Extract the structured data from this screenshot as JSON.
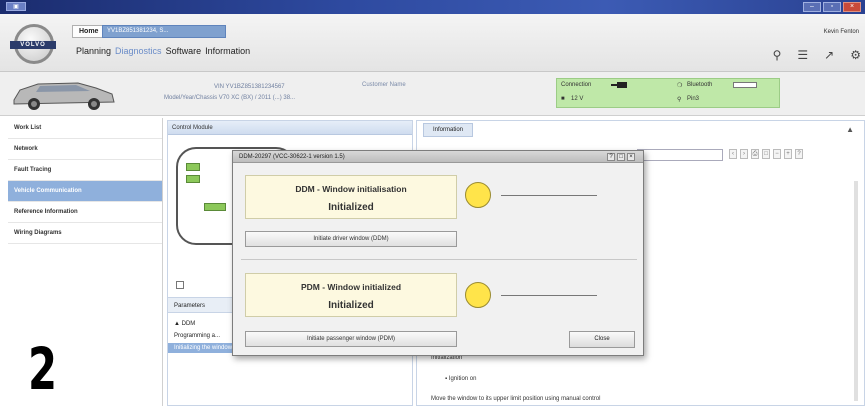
{
  "window": {
    "controls": [
      "–",
      "▫",
      "×"
    ]
  },
  "header": {
    "logo_text": "VOLVO",
    "tabs": [
      "Home",
      "YV1BZ851381234, S..."
    ],
    "nav": [
      "Planning",
      "Diagnostics",
      "Software",
      "Information"
    ],
    "active_nav": "Diagnostics",
    "user": "Kevin Fenton",
    "icons": [
      "search-icon",
      "list-icon",
      "link-icon",
      "settings-icon"
    ]
  },
  "vehicle": {
    "vin": "VIN  YV1BZ851381234567",
    "model_line": "Model/Year/Chassis  V70 XC (BX) / 2011 (...) 38...",
    "customer_label": "Customer Name",
    "status": {
      "connection": "Connection",
      "voltage": "12 V",
      "bluetooth": "Bluetooth",
      "pin": "Pin3"
    }
  },
  "left_nav": {
    "items": [
      "Work List",
      "Network",
      "Fault Tracing",
      "Vehicle Communication",
      "Reference Information",
      "Wiring Diagrams"
    ],
    "selected_index": 3,
    "step_number": "2"
  },
  "control_module": {
    "title": "Control Module",
    "params_header": "Parameters",
    "rows": [
      "▲ DDM",
      "Programming a...",
      "Initializing the window position"
    ]
  },
  "information": {
    "tab": "Information",
    "lines": [
      "Initialization",
      "▪    Ignition on",
      "Move the window to its upper limit position using manual control"
    ]
  },
  "dialog": {
    "title": "DDM-20297 (VCC-30622-1 version 1.5)",
    "ctrls": [
      "?",
      "□",
      "×"
    ],
    "cards": [
      {
        "title": "DDM - Window initialisation",
        "state": "Initialized",
        "button": "Initiate driver window (DDM)"
      },
      {
        "title": "PDM - Window initialized",
        "state": "Initialized",
        "button": "Initiate passenger window (PDM)"
      }
    ],
    "close": "Close",
    "lamp_color": "#ffe44a"
  }
}
